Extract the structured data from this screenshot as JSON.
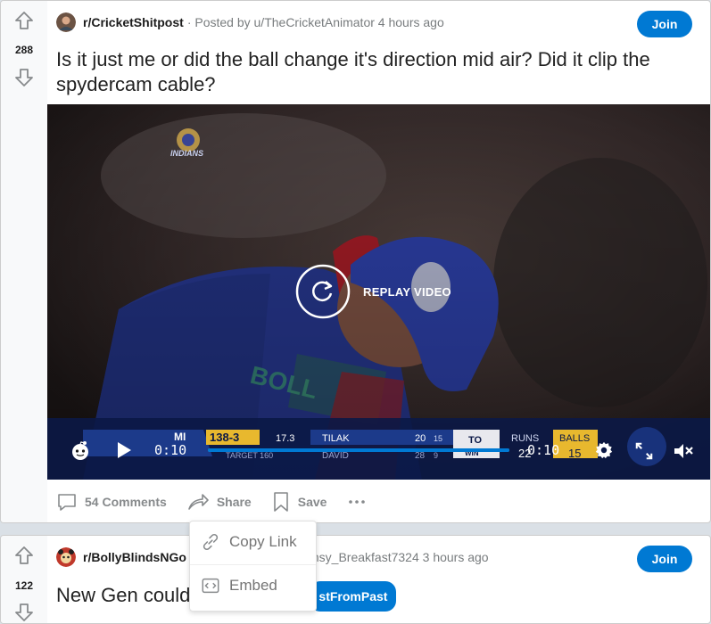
{
  "post1": {
    "votes": "288",
    "subreddit": "r/CricketShitpost",
    "byline": "· Posted by u/TheCricketAnimator 4 hours ago",
    "join_label": "Join",
    "title": "Is it just me or did the ball change it's direction mid air? Did it clip the spydercam cable?",
    "video": {
      "replay_label": "REPLAY VIDEO",
      "time_elapsed": "0:10",
      "time_total": "0:10",
      "progress": 1.0,
      "team_logo_text": "INDIANS",
      "jersey_text": "BOLL",
      "scoreboard": {
        "team": "MI",
        "score": "138-3",
        "overs": "17.3",
        "target": "TARGET 160",
        "batter1": "TILAK",
        "batter1_runs": "20",
        "batter1_balls": "15",
        "batter2": "DAVID",
        "batter2_runs": "28",
        "batter2_balls": "9",
        "to_win": "TO",
        "to_win_sub": "WIN",
        "runs_label": "RUNS",
        "runs_value": "22",
        "balls_label": "BALLS",
        "balls_value": "15"
      }
    },
    "actions": {
      "comments": "54 Comments",
      "share": "Share",
      "save": "Save"
    }
  },
  "share_menu": {
    "copy_link": "Copy Link",
    "embed": "Embed"
  },
  "post2": {
    "votes": "122",
    "subreddit": "r/BollyBlindsNGo",
    "byline": "imsy_Breakfast7324 3 hours ago",
    "join_label": "Join",
    "title": "New Gen could",
    "flair": "stFromPast"
  },
  "colors": {
    "join_blue": "#0079d3",
    "video_bar_blue": "#0079d3"
  }
}
